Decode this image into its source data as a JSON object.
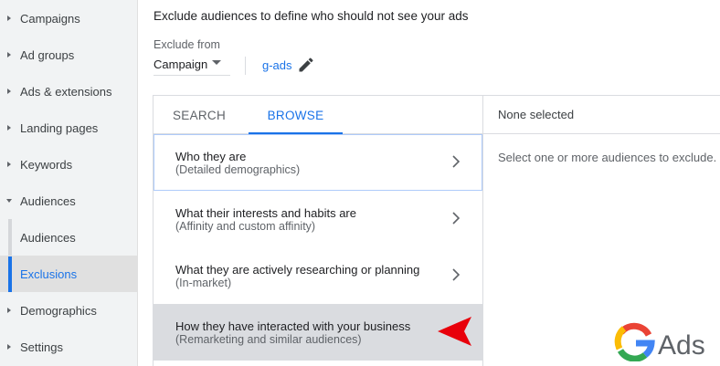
{
  "sidebar": {
    "items": [
      {
        "label": "Campaigns"
      },
      {
        "label": "Ad groups"
      },
      {
        "label": "Ads & extensions"
      },
      {
        "label": "Landing pages"
      },
      {
        "label": "Keywords"
      },
      {
        "label": "Audiences"
      },
      {
        "label": "Audiences"
      },
      {
        "label": "Exclusions"
      },
      {
        "label": "Demographics"
      },
      {
        "label": "Settings"
      }
    ]
  },
  "main": {
    "heading": "Exclude audiences to define who should not see your ads",
    "exclude_from_label": "Exclude from",
    "level_select": "Campaign",
    "campaign_name": "g-ads",
    "tabs": [
      {
        "label": "SEARCH"
      },
      {
        "label": "BROWSE"
      }
    ],
    "categories": [
      {
        "title": "Who they are",
        "subtitle": "(Detailed demographics)"
      },
      {
        "title": "What their interests and habits are",
        "subtitle": "(Affinity and custom affinity)"
      },
      {
        "title": "What they are actively researching or planning",
        "subtitle": "(In-market)"
      },
      {
        "title": "How they have interacted with your business",
        "subtitle": "(Remarketing and similar audiences)"
      }
    ],
    "selected_header": "None selected",
    "selected_hint": "Select one or more audiences to exclude."
  },
  "logo": {
    "text": "Ads"
  },
  "colors": {
    "accent": "#1a73e8",
    "annotation_arrow": "#e8000b",
    "sidebar_bg": "#f1f3f4"
  }
}
